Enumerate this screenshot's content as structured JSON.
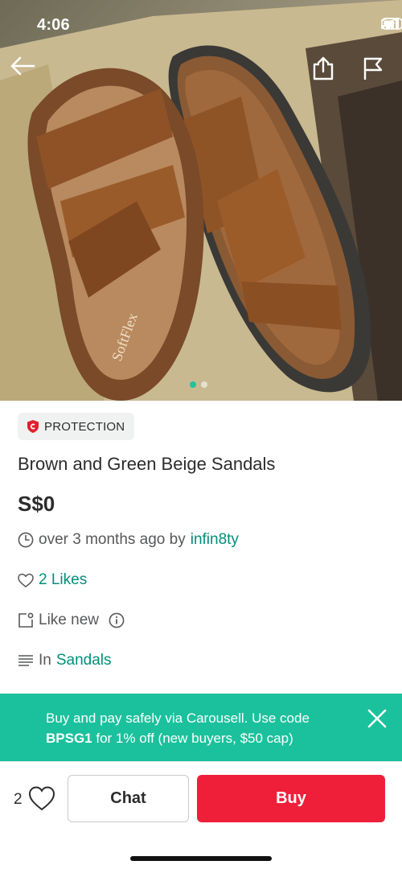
{
  "status_bar": {
    "time": "4:06"
  },
  "listing": {
    "protection_label": "PROTECTION",
    "title": "Brown and Green Beige Sandals",
    "price": "S$0",
    "posted_prefix": "over 3 months ago by",
    "seller": "infin8ty",
    "likes": "2 Likes",
    "condition": "Like new",
    "category_prefix": "In",
    "category": "Sandals"
  },
  "promo": {
    "line1": "Buy and pay safely via Carousell. Use code",
    "code": "BPSG1",
    "line2": "for 1% off (new buyers, $50 cap)"
  },
  "bottom_bar": {
    "like_count": "2",
    "chat_label": "Chat",
    "buy_label": "Buy"
  },
  "photos": {
    "count": 2,
    "current": 1
  },
  "colors": {
    "accent": "#008f79",
    "promo_bg": "#1bc19c",
    "buy_bg": "#ef1f3a",
    "protection_red": "#e0202e"
  }
}
